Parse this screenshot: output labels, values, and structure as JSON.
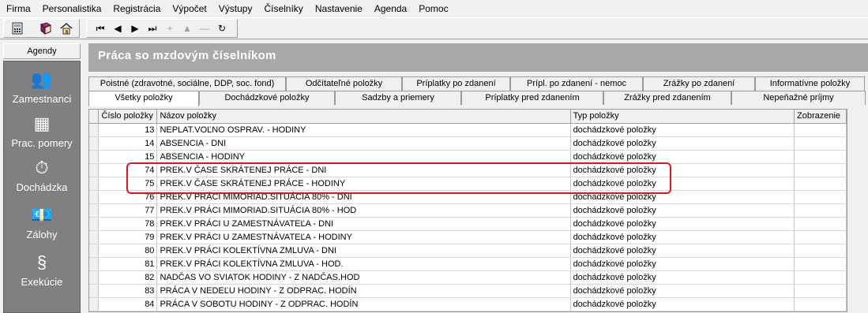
{
  "menu": [
    "Firma",
    "Personalistika",
    "Registrácia",
    "Výpočet",
    "Výstupy",
    "Číselníky",
    "Nastavenie",
    "Agenda",
    "Pomoc"
  ],
  "toolbar": {
    "icons": [
      "calculator-icon",
      "book-icon",
      "home-icon"
    ],
    "nav": [
      {
        "name": "first-record-button",
        "glyph": "⏮"
      },
      {
        "name": "prev-record-button",
        "glyph": "◀"
      },
      {
        "name": "next-record-button",
        "glyph": "▶"
      },
      {
        "name": "last-record-button",
        "glyph": "⏭"
      },
      {
        "name": "add-record-button",
        "glyph": "+"
      },
      {
        "name": "up-record-button",
        "glyph": "▲"
      },
      {
        "name": "delete-record-button",
        "glyph": "—"
      },
      {
        "name": "refresh-button",
        "glyph": "↻"
      }
    ]
  },
  "sidebar": {
    "title": "Agendy",
    "items": [
      {
        "label": "Zamestnanci",
        "icon": "people-icon",
        "glyph": "👥"
      },
      {
        "label": "Prac. pomery",
        "icon": "org-chart-icon",
        "glyph": "▦"
      },
      {
        "label": "Dochádzka",
        "icon": "clock-calendar-icon",
        "glyph": "⏱"
      },
      {
        "label": "Zálohy",
        "icon": "money-icon",
        "glyph": "💶"
      },
      {
        "label": "Exekúcie",
        "icon": "paragraph-icon",
        "glyph": "§"
      }
    ]
  },
  "header": {
    "title": "Práca so mzdovým číselníkom"
  },
  "tabs_row1": [
    "Poistné (zdravotné, sociálne, DDP, soc. fond)",
    "Odčítateľné položky",
    "Príplatky po zdanení",
    "Prípl. po zdanení - nemoc",
    "Zrážky po zdanení",
    "Informatívne položky"
  ],
  "tabs_row2": [
    "Všetky položky",
    "Dochádzkové položky",
    "Sadzby a priemery",
    "Príplatky pred zdanením",
    "Zrážky pred zdanením",
    "Nepeňažné príjmy"
  ],
  "table": {
    "columns": [
      "Číslo položky",
      "Názov položky",
      "Typ položky",
      "Zobrazenie"
    ],
    "rows": [
      {
        "cislo": "13",
        "nazov": "NEPLAT.VOĽNO OSPRAV. - HODINY",
        "typ": "dochádzkové položky",
        "zobrazenie": ""
      },
      {
        "cislo": "14",
        "nazov": "ABSENCIA - DNI",
        "typ": "dochádzkové položky",
        "zobrazenie": ""
      },
      {
        "cislo": "15",
        "nazov": "ABSENCIA - HODINY",
        "typ": "dochádzkové položky",
        "zobrazenie": ""
      },
      {
        "cislo": "74",
        "nazov": "PREK.V ČASE SKRÁTENEJ PRÁCE - DNI",
        "typ": "dochádzkové položky",
        "zobrazenie": ""
      },
      {
        "cislo": "75",
        "nazov": "PREK.V ČASE SKRÁTENEJ PRÁCE - HODINY",
        "typ": "dochádzkové položky",
        "zobrazenie": ""
      },
      {
        "cislo": "76",
        "nazov": "PREK.V PRÁCI MIMORIAD.SITUÁCIA 80% - DNI",
        "typ": "dochádzkové položky",
        "zobrazenie": ""
      },
      {
        "cislo": "77",
        "nazov": "PREK.V PRÁCI MIMORIAD.SITUÁCIA 80% - HOD",
        "typ": "dochádzkové položky",
        "zobrazenie": ""
      },
      {
        "cislo": "78",
        "nazov": "PREK.V PRÁCI U ZAMESTNÁVATEĽA - DNI",
        "typ": "dochádzkové položky",
        "zobrazenie": ""
      },
      {
        "cislo": "79",
        "nazov": "PREK.V PRÁCI U ZAMESTNÁVATEĽA - HODINY",
        "typ": "dochádzkové položky",
        "zobrazenie": ""
      },
      {
        "cislo": "80",
        "nazov": "PREK.V PRÁCI  KOLEKTÍVNA  ZMLUVA  - DNI",
        "typ": "dochádzkové položky",
        "zobrazenie": ""
      },
      {
        "cislo": "81",
        "nazov": "PREK.V PRÁCI  KOLEKTÍVNA ZMLUVA - HOD.",
        "typ": "dochádzkové položky",
        "zobrazenie": ""
      },
      {
        "cislo": "82",
        "nazov": "NADČAS VO SVIATOK HODINY -  Z NADČAS.HOD",
        "typ": "dochádzkové položky",
        "zobrazenie": ""
      },
      {
        "cislo": "83",
        "nazov": "PRÁCA V NEDEĽU HODINY - Z ODPRAC. HODÍN",
        "typ": "dochádzkové položky",
        "zobrazenie": ""
      },
      {
        "cislo": "84",
        "nazov": "PRÁCA V SOBOTU HODINY - Z ODPRAC. HODÍN",
        "typ": "dochádzkové položky",
        "zobrazenie": ""
      }
    ]
  },
  "colors": {
    "highlight": "#e0141e",
    "header_bg": "#a8a8a8",
    "sidebar_bg": "#808080"
  }
}
